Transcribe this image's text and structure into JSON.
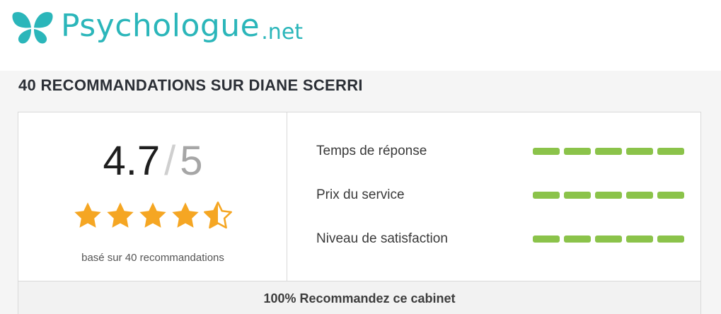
{
  "brand": {
    "name": "Psychologue",
    "tld": ".net",
    "color": "#2bb6ba"
  },
  "title": "40 RECOMMANDATIONS SUR DIANE SCERRI",
  "rating": {
    "score": "4.7",
    "separator": "/",
    "max": "5",
    "stars_value": 4.5,
    "star_color": "#f5a623",
    "based_on": "basé sur 40 recommandations"
  },
  "criteria": [
    {
      "label": "Temps de réponse",
      "level": 5,
      "out_of": 5
    },
    {
      "label": "Prix du service",
      "level": 5,
      "out_of": 5
    },
    {
      "label": "Niveau de satisfaction",
      "level": 5,
      "out_of": 5
    }
  ],
  "bar_color": "#8bc34a",
  "footer": {
    "text": "100% Recommandez ce cabinet"
  }
}
